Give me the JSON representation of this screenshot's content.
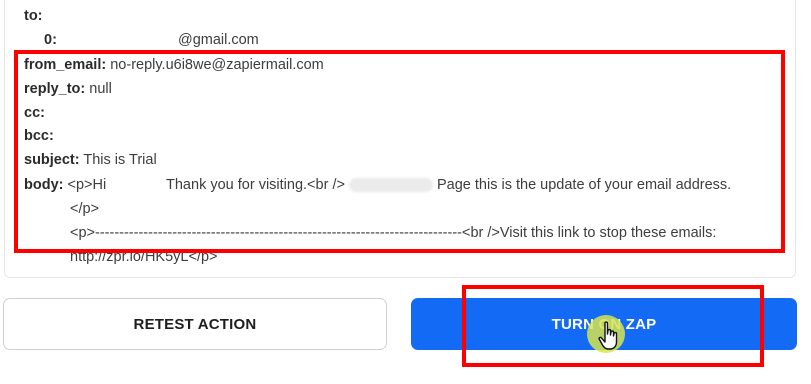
{
  "fields": {
    "to": {
      "key": "to:"
    },
    "to_item": {
      "index": "0:",
      "value": "@gmail.com"
    },
    "from_email": {
      "key": "from_email:",
      "value": "no-reply.u6i8we@zapiermail.com"
    },
    "reply_to": {
      "key": "reply_to:",
      "value": "null"
    },
    "cc": {
      "key": "cc:"
    },
    "bcc": {
      "key": "bcc:"
    },
    "subject": {
      "key": "subject:",
      "value": "This is Trial"
    },
    "body": {
      "key": "body:",
      "line1_a": "<p>Hi",
      "line1_b": "Thank you for visiting.<br />",
      "line1_c": "Page this is the update of your email address.",
      "line2": "</p>",
      "line3": "<p>----------------------------------------------------------------------------<br />Visit this link to stop these emails:",
      "line4": "http://zpr.io/HK5yL</p>"
    }
  },
  "buttons": {
    "retest": "RETEST ACTION",
    "turn_on": "TURN ON ZAP"
  },
  "colors": {
    "primary": "#136bf5",
    "annotation": "#ff0000",
    "cursor_halo": "#d6e450"
  }
}
